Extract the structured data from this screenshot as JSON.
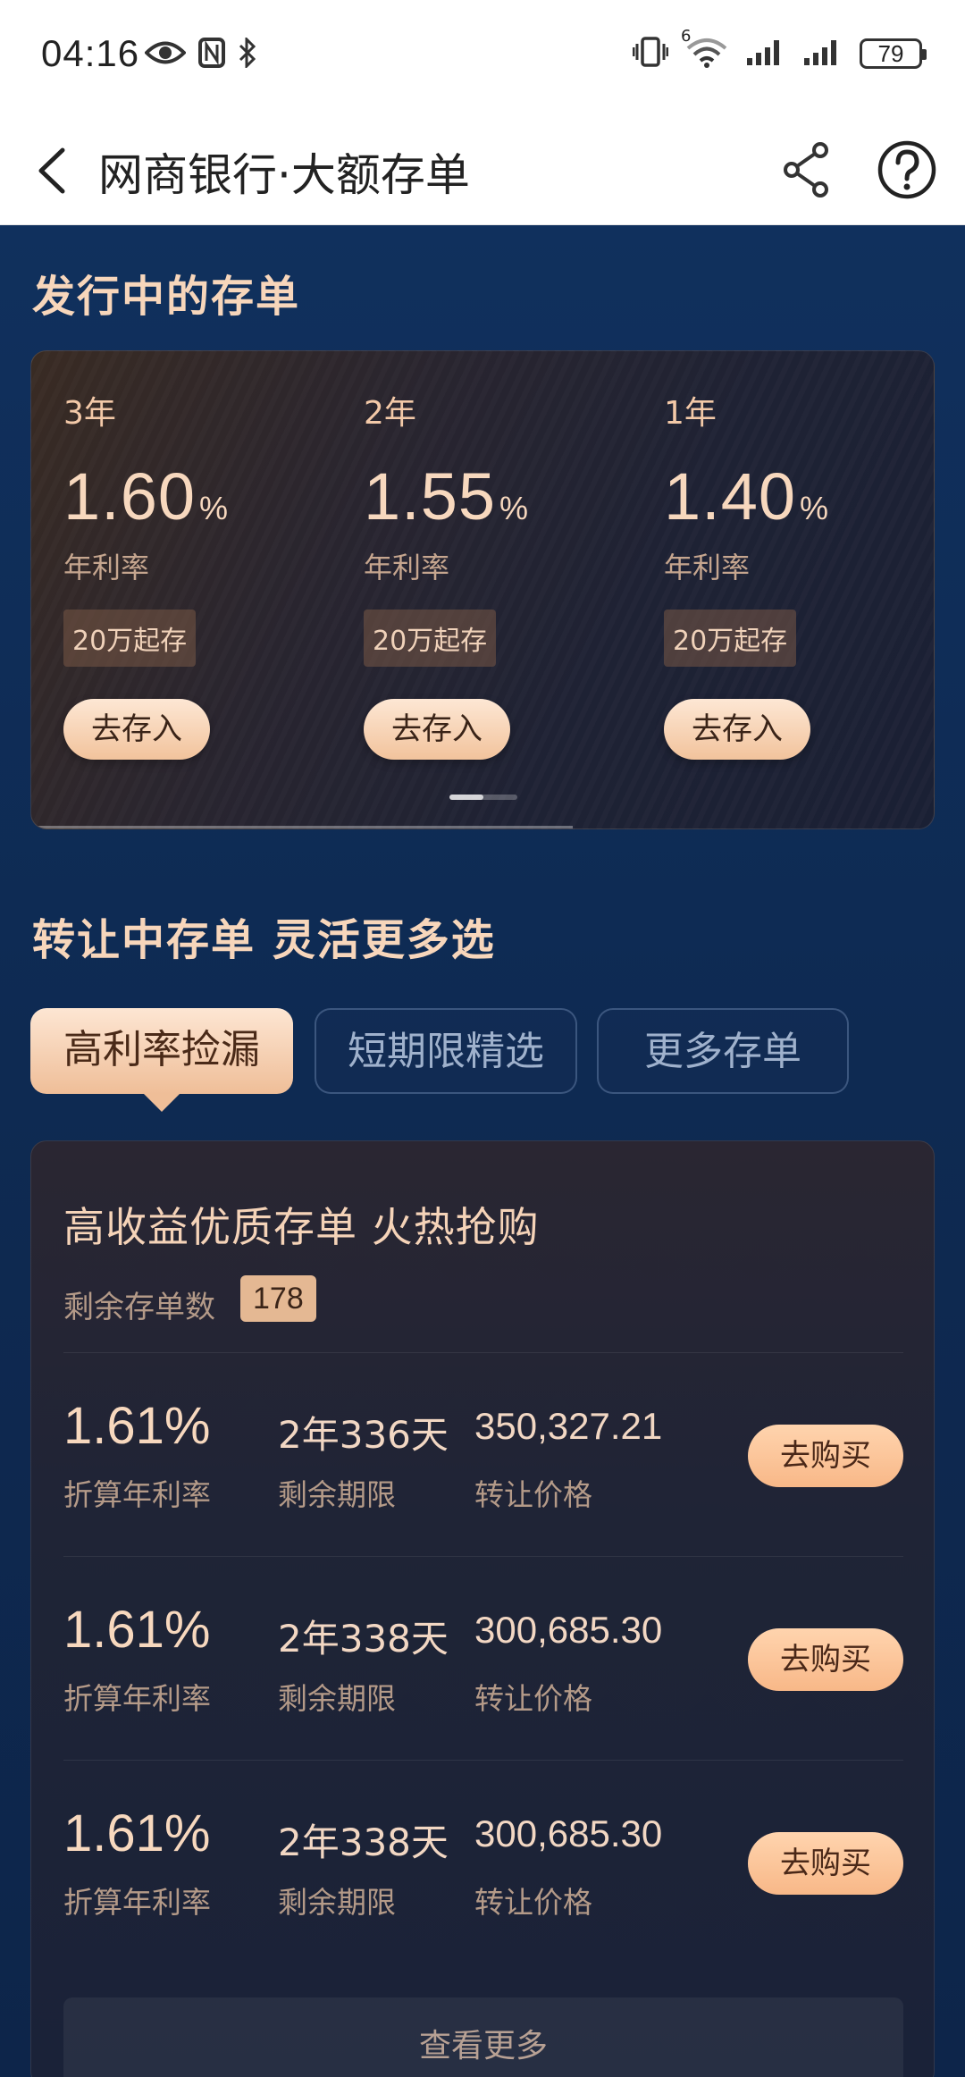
{
  "status_bar": {
    "time": "04:16",
    "battery": "79",
    "network_tag": "6"
  },
  "header": {
    "title": "网商银行·大额存单"
  },
  "issuing": {
    "section_title": "发行中的存单",
    "products": [
      {
        "term": "3年",
        "rate": "1.60",
        "unit": "%",
        "rate_label": "年利率",
        "min_deposit": "20万起存",
        "action": "去存入"
      },
      {
        "term": "2年",
        "rate": "1.55",
        "unit": "%",
        "rate_label": "年利率",
        "min_deposit": "20万起存",
        "action": "去存入"
      },
      {
        "term": "1年",
        "rate": "1.40",
        "unit": "%",
        "rate_label": "年利率",
        "min_deposit": "20万起存",
        "action": "去存入"
      }
    ]
  },
  "transfer": {
    "section_title": "转让中存单 灵活更多选",
    "tabs": [
      {
        "label": "高利率捡漏",
        "active": true
      },
      {
        "label": "短期限精选",
        "active": false
      },
      {
        "label": "更多存单",
        "active": false
      }
    ],
    "card_title": "高收益优质存单 火热抢购",
    "remaining_label": "剩余存单数",
    "remaining_count": "178",
    "rows": [
      {
        "rate": "1.61%",
        "rate_label": "折算年利率",
        "term": "2年336天",
        "term_label": "剩余期限",
        "price": "350,327.21",
        "price_label": "转让价格",
        "action": "去购买"
      },
      {
        "rate": "1.61%",
        "rate_label": "折算年利率",
        "term": "2年338天",
        "term_label": "剩余期限",
        "price": "300,685.30",
        "price_label": "转让价格",
        "action": "去购买"
      },
      {
        "rate": "1.61%",
        "rate_label": "折算年利率",
        "term": "2年338天",
        "term_label": "剩余期限",
        "price": "300,685.30",
        "price_label": "转让价格",
        "action": "去购买"
      }
    ],
    "view_more": "查看更多"
  },
  "icons": {
    "back": "chevron-left-icon",
    "share": "share-icon",
    "help": "help-icon",
    "eye": "eye-icon",
    "nfc": "nfc-icon",
    "bluetooth": "bluetooth-icon",
    "vibrate": "vibrate-icon",
    "wifi": "wifi-icon",
    "signal": "signal-icon"
  },
  "colors": {
    "accent": "#f7d8be",
    "button": "#f8b888",
    "background": "#0f2a52"
  }
}
